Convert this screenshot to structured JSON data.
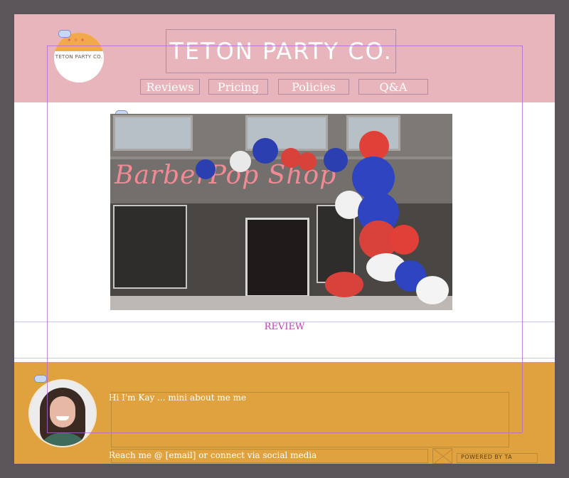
{
  "header": {
    "logo_text": "TETON PARTY CO.",
    "title": "TETON PARTY CO.",
    "nav": [
      {
        "label": "Reviews"
      },
      {
        "label": "Pricing"
      },
      {
        "label": "Policies"
      },
      {
        "label": "Q&A"
      }
    ]
  },
  "hero": {
    "sign_text": "BarberPop Shop"
  },
  "review_section": {
    "label": "REVIEW"
  },
  "footer": {
    "bio": "Hi I'm Kay ... mini about me me",
    "contact": "Reach me @ [email] or connect via social media",
    "powered": "POWERED BY TA"
  },
  "colors": {
    "header_bg": "#e8b5bc",
    "footer_bg": "#e0a23e",
    "review_label": "#c040b0"
  }
}
